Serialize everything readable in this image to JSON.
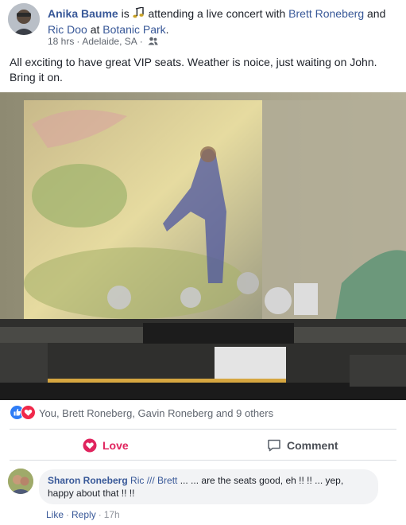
{
  "post": {
    "author": "Anika Baume",
    "activity_text": "is",
    "activity_verb": "attending a live concert with",
    "tagged_1": "Brett Roneberg",
    "and_text": "and",
    "tagged_2": "Ric Doo",
    "at_text": "at",
    "place": "Botanic Park",
    "period": ".",
    "time": "18 hrs",
    "location": "Adelaide, SA",
    "body": "All exciting to have great VIP seats. Weather is noice, just waiting on John. Bring it on."
  },
  "reactions": {
    "summary": "You, Brett Roneberg, Gavin Roneberg and 9 others",
    "icons": [
      "like-icon",
      "love-icon"
    ],
    "like_color": "#2f7df6",
    "love_color": "#f0284a"
  },
  "actions": {
    "love_label": "Love",
    "comment_label": "Comment",
    "love_color": "#e0245e"
  },
  "comment": {
    "author": "Sharon Roneberg",
    "tag": "Ric /// Brett",
    "text": "... ... are the seats good, eh !! !! ... yep, happy about that !! !!",
    "like_label": "Like",
    "reply_label": "Reply",
    "time": "17h"
  },
  "colors": {
    "link": "#385898",
    "meta": "#616770",
    "divider": "#dadde1"
  }
}
